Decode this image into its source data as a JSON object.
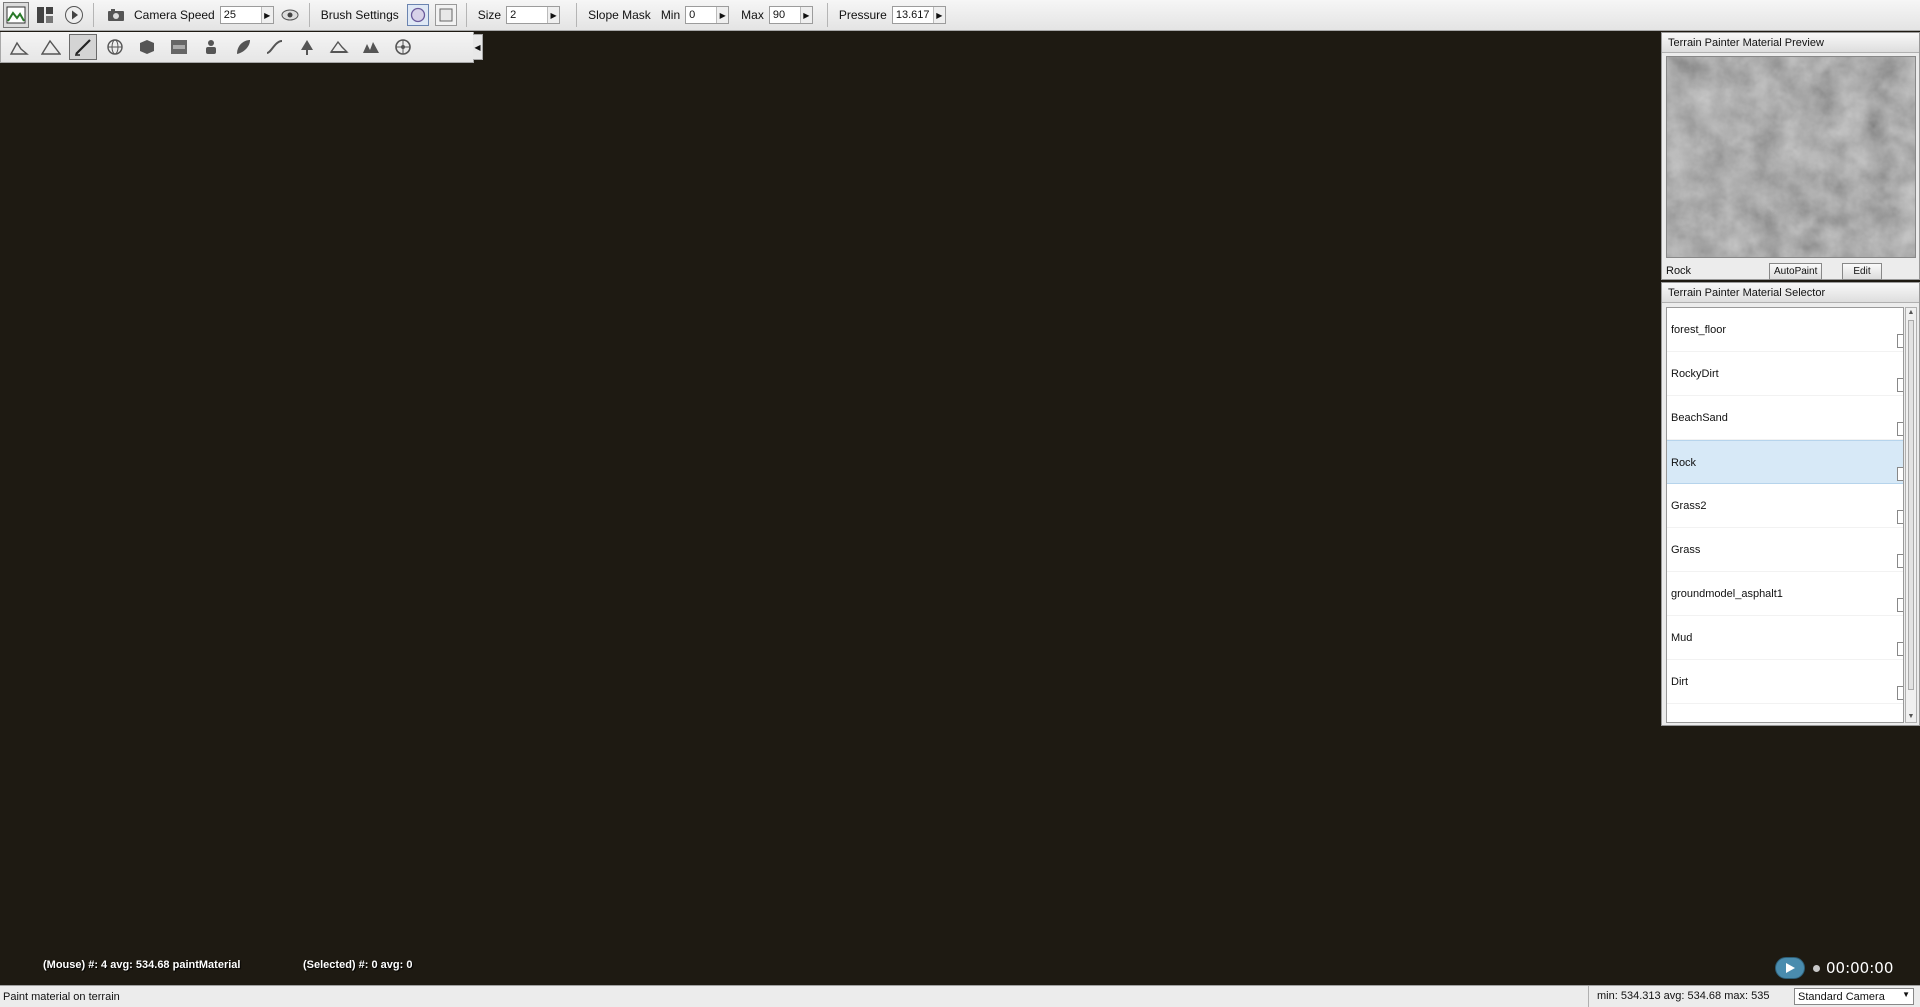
{
  "toolbar": {
    "camera_speed_label": "Camera Speed",
    "camera_speed_value": "25",
    "brush_settings_label": "Brush Settings",
    "size_label": "Size",
    "size_value": "2",
    "slope_mask_label": "Slope Mask",
    "min_label": "Min",
    "min_value": "0",
    "max_label": "Max",
    "max_value": "90",
    "pressure_label": "Pressure",
    "pressure_value": "13.617"
  },
  "tools": [
    "terrain-raise-icon",
    "terrain-adjust-icon",
    "paint-brush-icon",
    "globe-icon",
    "cube-icon",
    "path-icon",
    "figure-icon",
    "leaf-icon",
    "smooth-icon",
    "tree-icon",
    "flatten-icon",
    "noise-icon",
    "wheel-icon"
  ],
  "preview_panel": {
    "title": "Terrain Painter Material Preview",
    "material_name": "Rock",
    "autopaint_label": "AutoPaint",
    "edit_label": "Edit"
  },
  "selector_panel": {
    "title": "Terrain Painter Material Selector",
    "materials": [
      "forest_floor",
      "RockyDirt",
      "BeachSand",
      "Rock",
      "Grass2",
      "Grass",
      "groundmodel_asphalt1",
      "Mud",
      "Dirt"
    ],
    "selected": "Rock"
  },
  "hud": {
    "mouse_info": "(Mouse) #: 4  avg: 534.68 paintMaterial",
    "selected_info": "(Selected) #: 0  avg: 0"
  },
  "playback": {
    "time": "00:00:00"
  },
  "status": {
    "left_text": "Paint material on terrain",
    "stats": "min: 534.313  avg: 534.68  max: 535",
    "camera": "Standard Camera"
  },
  "colors": {
    "selected_row": "#d7e9f7",
    "brush_outline": "#c040c0",
    "play_button": "#4a8cae"
  }
}
